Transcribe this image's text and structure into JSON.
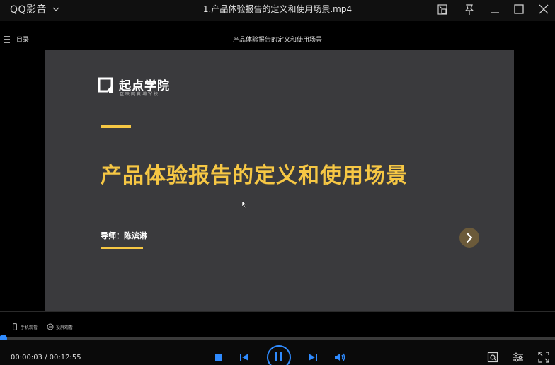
{
  "app": {
    "name": "QQ影音",
    "file_title": "1.产品体验报告的定义和使用场景.mp4"
  },
  "topstrip": {
    "menu_label": "目录",
    "title": "产品体验报告的定义和使用场景"
  },
  "slide": {
    "brand_name": "起点学院",
    "brand_sub": "互联网黄埔军校",
    "title": "产品体验报告的定义和使用场景",
    "mentor": "导师：陈滨淋"
  },
  "subbar": {
    "phone_label": "手机观看",
    "cast_label": "投屏观看"
  },
  "playback": {
    "current_time": "00:00:03",
    "total_time": "00:12:55",
    "time_display": "00:00:03 / 00:12:55",
    "progress_fraction": 0.004
  },
  "colors": {
    "accent_yellow": "#f6c744",
    "progress_blue": "#2f8bff",
    "slide_bg": "#3a3a3d"
  },
  "icons": {
    "menu": "menu-icon",
    "mini_mode": "mini-mode-icon",
    "pin": "pin-icon",
    "minimize": "minimize-icon",
    "maximize": "maximize-icon",
    "close": "close-icon",
    "stop": "stop-icon",
    "prev": "previous-icon",
    "pause": "pause-icon",
    "next": "next-icon",
    "volume": "volume-icon",
    "screenshot": "screenshot-icon",
    "settings": "settings-icon",
    "fullscreen": "fullscreen-icon"
  }
}
